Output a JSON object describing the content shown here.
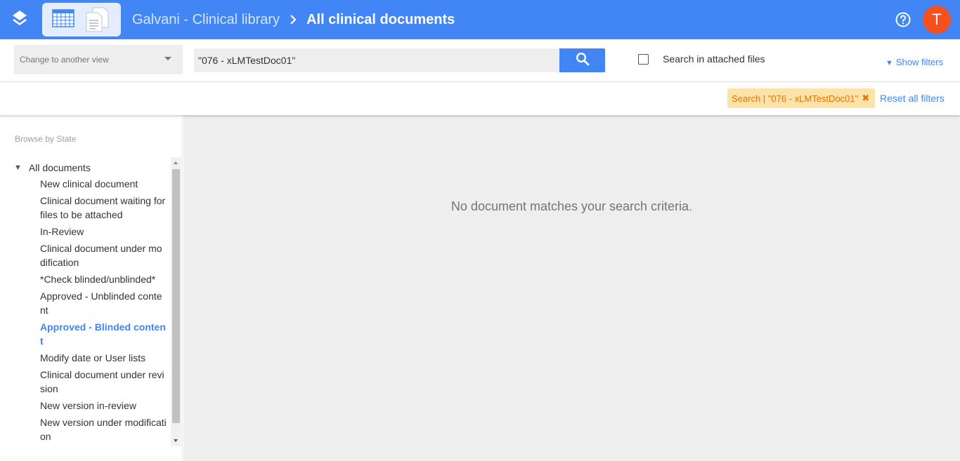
{
  "header": {
    "breadcrumb_parent": "Galvani - Clinical library",
    "breadcrumb_current": "All clinical documents",
    "avatar_initial": "T",
    "colors": {
      "bar": "#4285f4",
      "avatar": "#f4511e"
    },
    "icons": [
      "app-logo-icon",
      "table-view-icon",
      "documents-view-icon",
      "chevron-right-icon",
      "help-icon"
    ]
  },
  "toolbar": {
    "view_select_placeholder": "Change to another view",
    "search_value": "\"076 - xLMTestDoc01\"",
    "attach_label": "Search in attached files",
    "attach_checked": false,
    "show_filters": "Show filters"
  },
  "filters": {
    "chip_label": "Search | \"076 - xLMTestDoc01\"",
    "chip_close": "✖",
    "reset_label": "Reset all filters"
  },
  "sidebar": {
    "heading": "Browse by State",
    "root_label": "All documents",
    "items": [
      "New clinical document",
      "Clinical document waiting for files to be attached",
      "In-Review",
      "Clinical document under modification",
      "*Check blinded/unblinded*",
      "Approved - Unblinded content",
      "Approved - Blinded content",
      "Modify date or User lists",
      "Clinical document under revision",
      "New version in-review",
      "New version under modification"
    ],
    "active_index": 6
  },
  "main": {
    "empty_message": "No document matches your search criteria."
  }
}
